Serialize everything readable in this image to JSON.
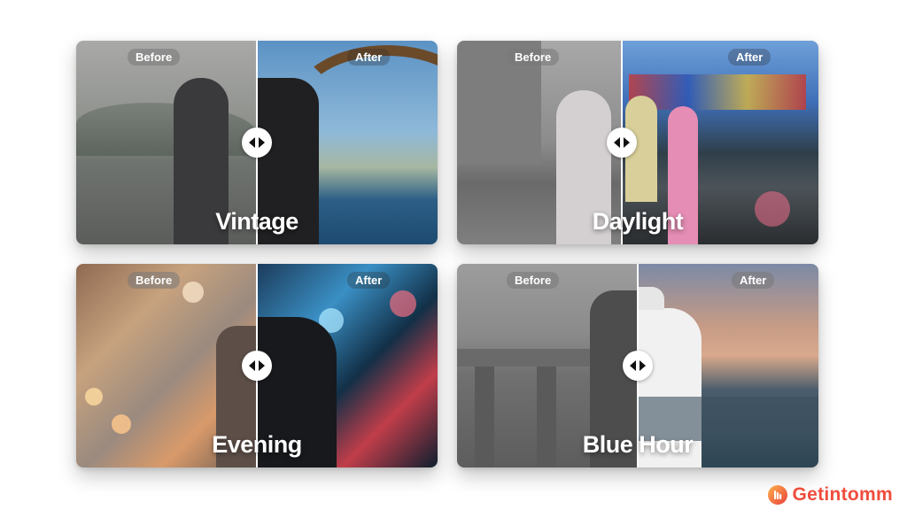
{
  "cards": [
    {
      "title": "Vintage",
      "before_label": "Before",
      "after_label": "After"
    },
    {
      "title": "Daylight",
      "before_label": "Before",
      "after_label": "After"
    },
    {
      "title": "Evening",
      "before_label": "Before",
      "after_label": "After"
    },
    {
      "title": "Blue Hour",
      "before_label": "Before",
      "after_label": "After"
    }
  ],
  "brand": {
    "name": "Getintomm",
    "color": "#ef4d3d"
  },
  "icons": {
    "handle": "left-right-arrows-icon",
    "logo": "getintomm-logo-icon"
  }
}
